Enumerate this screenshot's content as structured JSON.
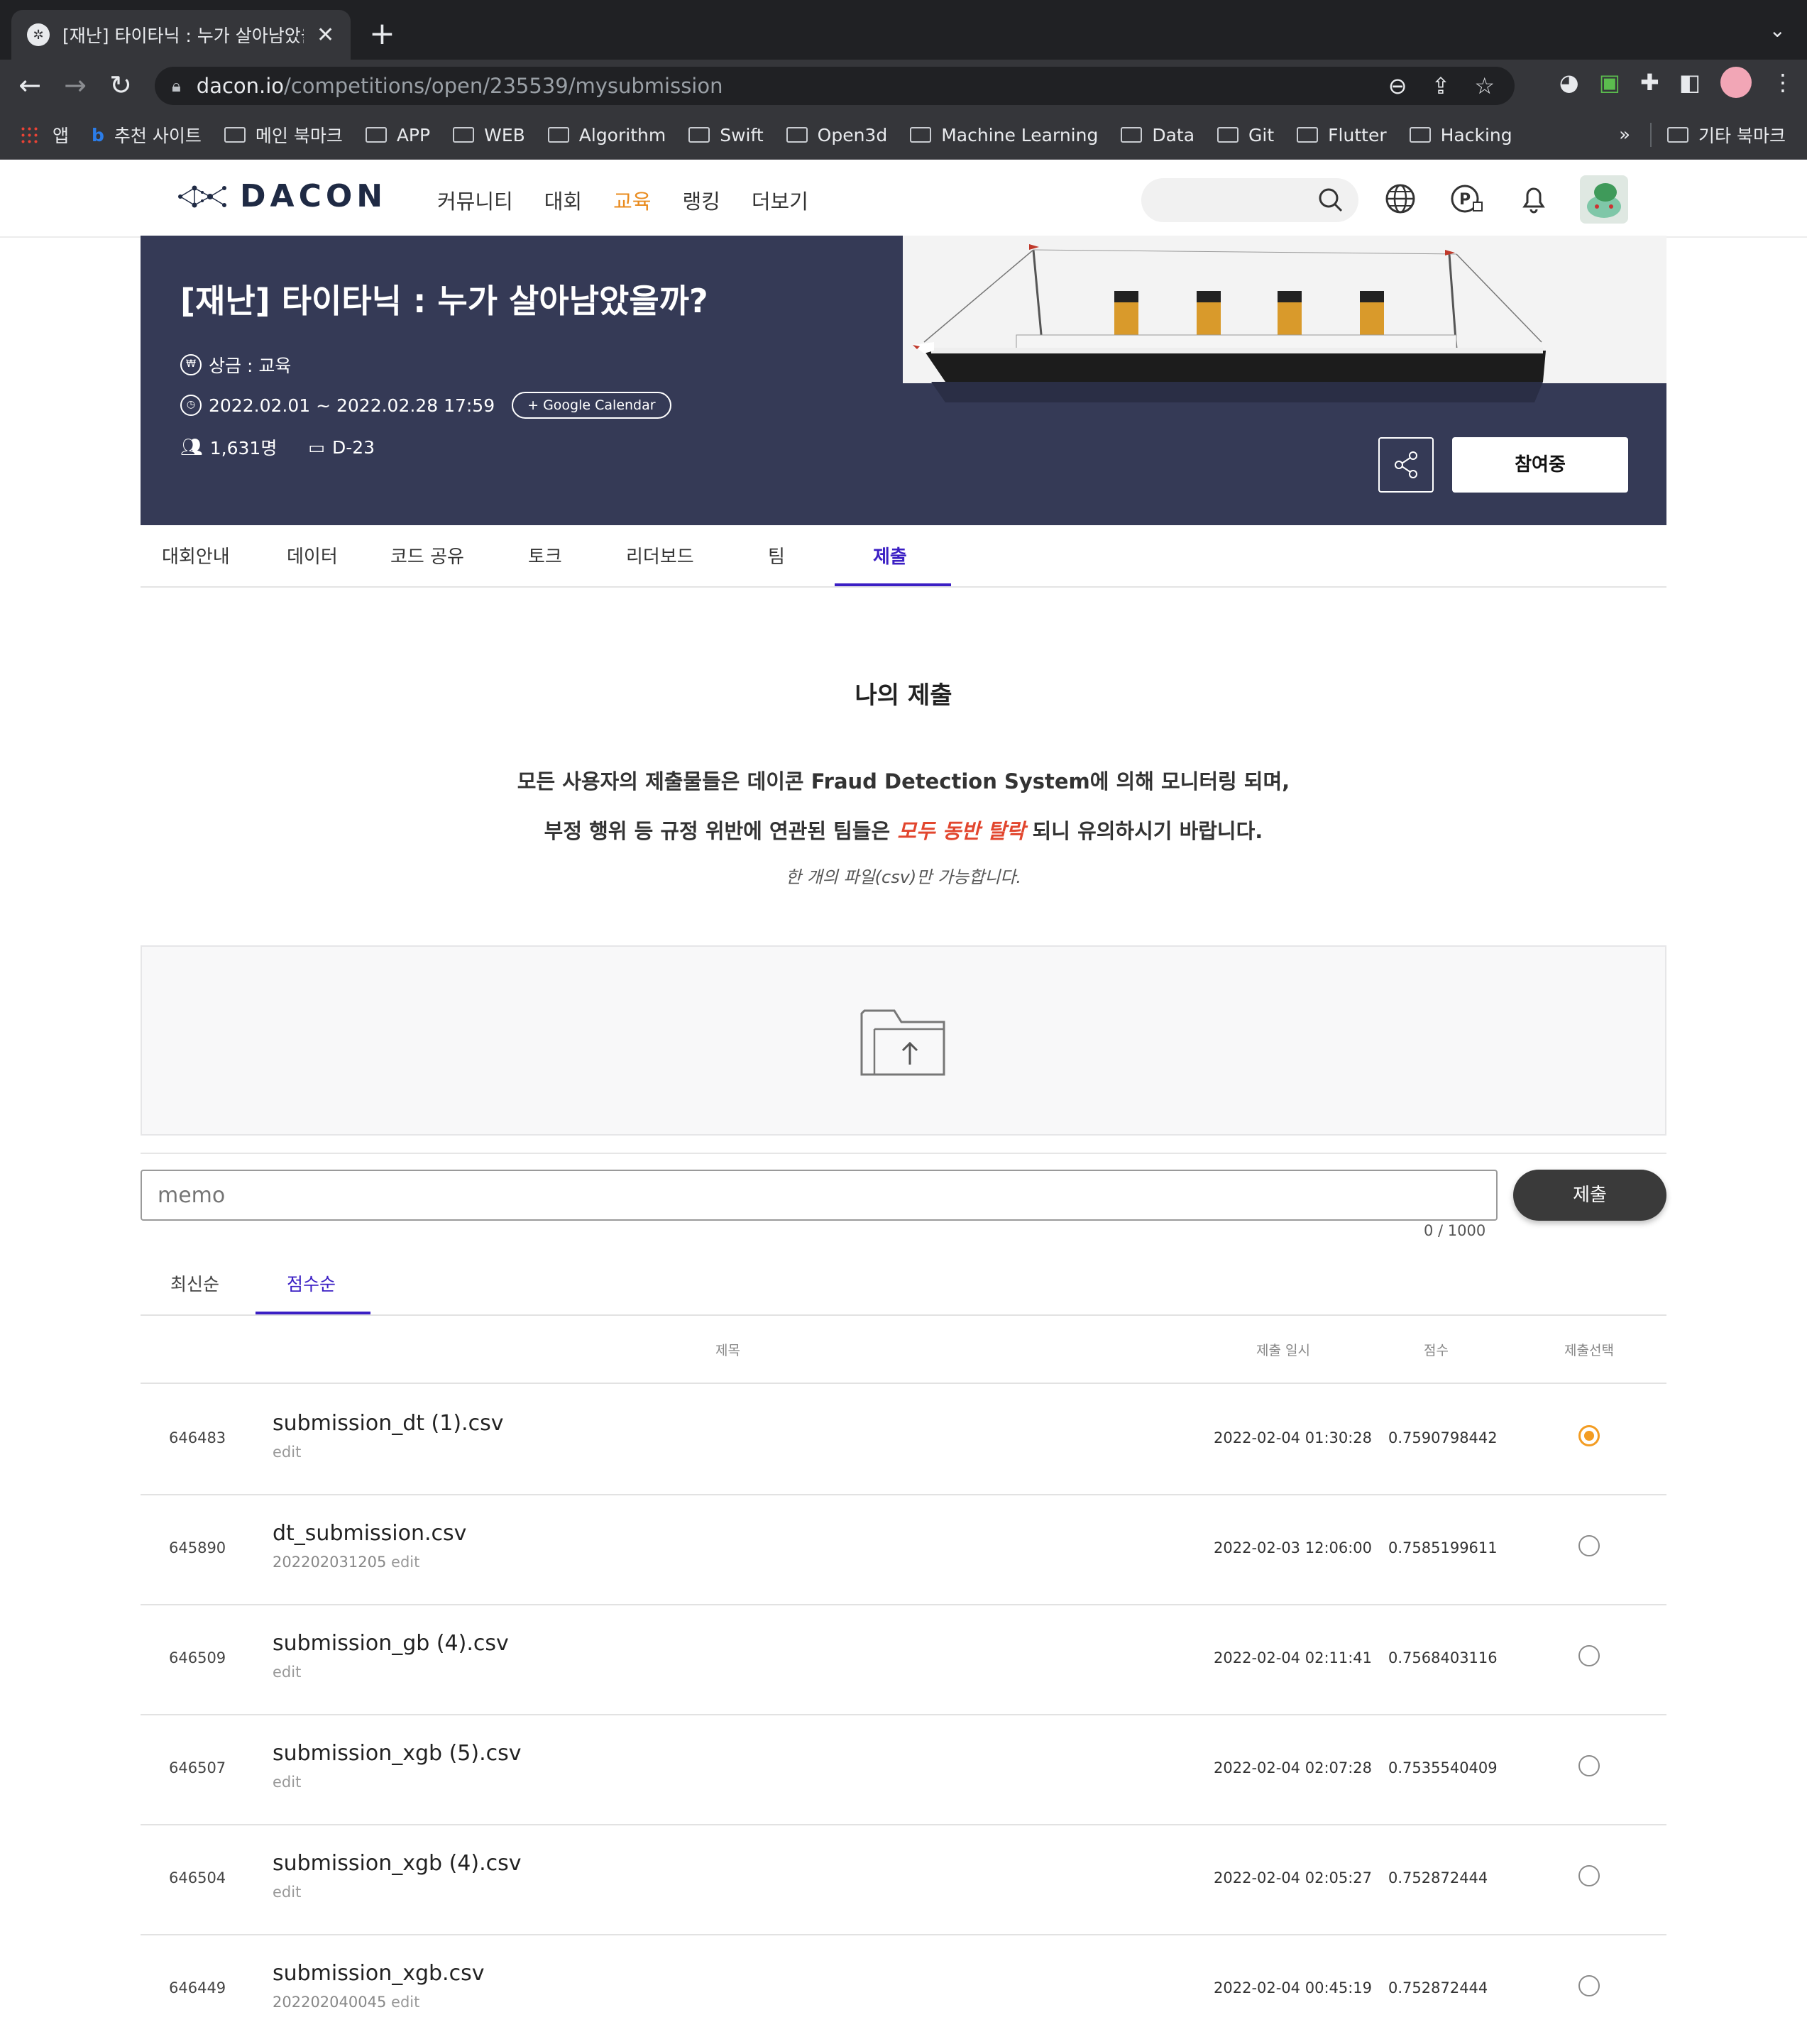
{
  "browser": {
    "tab_title": "[재난] 타이타닉 : 누가 살아남았을까",
    "url_host": "dacon.io",
    "url_path": "/competitions/open/235539/mysubmission",
    "bookmarks": [
      "앱",
      "추천 사이트",
      "메인 북마크",
      "APP",
      "WEB",
      "Algorithm",
      "Swift",
      "Open3d",
      "Machine Learning",
      "Data",
      "Git",
      "Flutter",
      "Hacking"
    ],
    "bookmarks_more": "»",
    "bookmarks_other": "기타 북마크"
  },
  "site": {
    "logo": "DACON",
    "nav": [
      "커뮤니티",
      "대회",
      "교육",
      "랭킹",
      "더보기"
    ],
    "active_nav": "교육",
    "accent": "#e98b1e"
  },
  "banner": {
    "title": "[재난] 타이타닉 : 누가 살아남았을까?",
    "prize": "상금 : 교육",
    "period": "2022.02.01 ~ 2022.02.28 17:59",
    "gcal": "+ Google Calendar",
    "participants": "1,631명",
    "dday": "D-23",
    "join_label": "참여중",
    "bg_color": "#353a56"
  },
  "subtabs": [
    "대회안내",
    "데이터",
    "코드 공유",
    "토크",
    "리더보드",
    "팀",
    "제출"
  ],
  "active_subtab": "제출",
  "content": {
    "title": "나의 제출",
    "notice_line1": "모든 사용자의 제출물들은 데이콘 Fraud Detection System에 의해 모니터링 되며,",
    "notice_line2_pre": "부정 행위 등 규정 위반에 연관된 팀들은 ",
    "notice_line2_warn": "모두 동반 탈락",
    "notice_line2_post": " 되니 유의하시기 바랍니다.",
    "file_note": "한 개의 파일(csv)만 가능합니다.",
    "memo_placeholder": "memo",
    "memo_count": "0 / 1000",
    "submit_label": "제출"
  },
  "sort_tabs": [
    "최신순",
    "점수순"
  ],
  "active_sort": "점수순",
  "table": {
    "headers": {
      "title": "제목",
      "date": "제출 일시",
      "score": "점수",
      "select": "제출선택"
    },
    "rows": [
      {
        "id": "646483",
        "file": "submission_dt (1).csv",
        "memo": "",
        "edit": "edit",
        "date": "2022-02-04 01:30:28",
        "score": "0.7590798442",
        "selected": true
      },
      {
        "id": "645890",
        "file": "dt_submission.csv",
        "memo": "202202031205",
        "edit": "edit",
        "date": "2022-02-03 12:06:00",
        "score": "0.7585199611",
        "selected": false
      },
      {
        "id": "646509",
        "file": "submission_gb (4).csv",
        "memo": "",
        "edit": "edit",
        "date": "2022-02-04 02:11:41",
        "score": "0.7568403116",
        "selected": false
      },
      {
        "id": "646507",
        "file": "submission_xgb (5).csv",
        "memo": "",
        "edit": "edit",
        "date": "2022-02-04 02:07:28",
        "score": "0.7535540409",
        "selected": false
      },
      {
        "id": "646504",
        "file": "submission_xgb (4).csv",
        "memo": "",
        "edit": "edit",
        "date": "2022-02-04 02:05:27",
        "score": "0.752872444",
        "selected": false
      },
      {
        "id": "646449",
        "file": "submission_xgb.csv",
        "memo": "202202040045",
        "edit": "edit",
        "date": "2022-02-04 00:45:19",
        "score": "0.752872444",
        "selected": false
      }
    ]
  }
}
